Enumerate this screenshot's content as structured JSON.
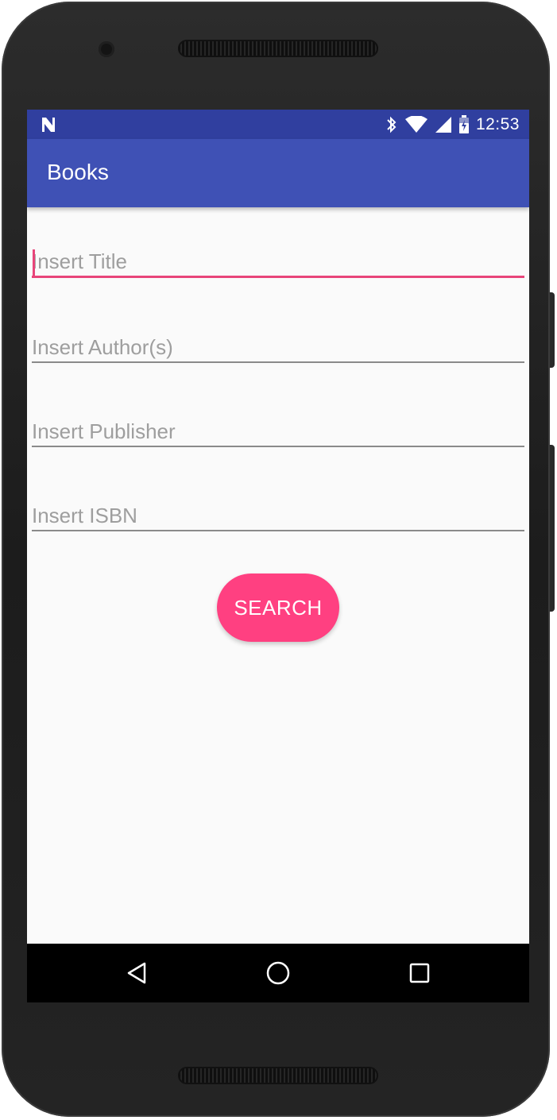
{
  "status_bar": {
    "time": "12:53",
    "icons": [
      "notification-n-icon",
      "bluetooth-icon",
      "wifi-icon",
      "cell-signal-icon",
      "battery-charging-icon"
    ]
  },
  "app_bar": {
    "title": "Books"
  },
  "form": {
    "title_placeholder": "Insert Title",
    "title_value": "",
    "authors_placeholder": "Insert Author(s)",
    "authors_value": "",
    "publisher_placeholder": "Insert Publisher",
    "publisher_value": "",
    "isbn_placeholder": "Insert ISBN",
    "isbn_value": "",
    "search_label": "SEARCH"
  },
  "navigation": {
    "icons": [
      "back-icon",
      "home-icon",
      "recents-icon"
    ]
  },
  "colors": {
    "status_bar": "#303f9f",
    "app_bar": "#3f51b5",
    "accent": "#ff4081",
    "focus_underline": "#e8457a",
    "background": "#fafafa"
  }
}
